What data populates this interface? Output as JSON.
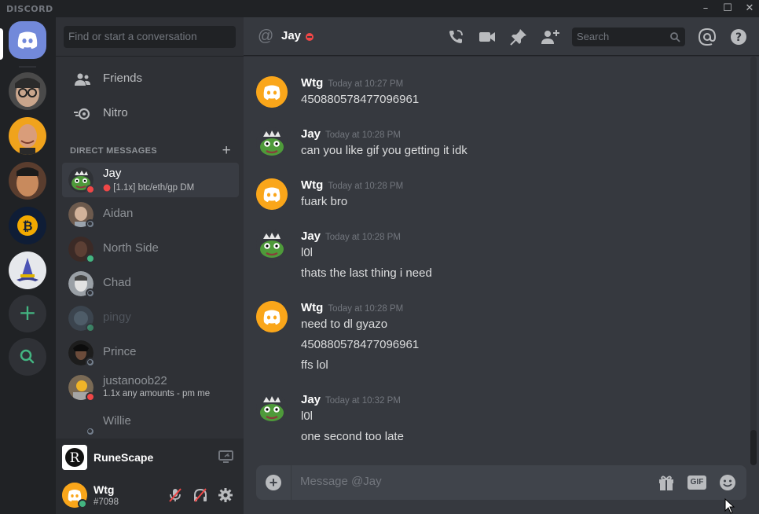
{
  "app": {
    "brand": "DISCORD"
  },
  "window_controls": {
    "minimize": "–",
    "maximize": "☐",
    "close": "✕"
  },
  "servers": [
    {
      "name": "home",
      "icon": "discord-logo-icon"
    },
    {
      "name": "server-1",
      "icon": "avatar-glasses"
    },
    {
      "name": "server-2",
      "icon": "avatar-smiling"
    },
    {
      "name": "server-3",
      "icon": "avatar-face"
    },
    {
      "name": "server-4",
      "icon": "bitcoin-icon"
    },
    {
      "name": "server-5",
      "icon": "wizard-hat-icon"
    }
  ],
  "rail_actions": {
    "add": "+",
    "explore_icon": "search-icon"
  },
  "sidebar": {
    "search_placeholder": "Find or start a conversation",
    "nav": [
      {
        "label": "Friends",
        "icon": "friends-icon"
      },
      {
        "label": "Nitro",
        "icon": "nitro-icon"
      }
    ],
    "dm_header": "DIRECT MESSAGES",
    "dm_add": "+",
    "dms": [
      {
        "name": "Jay",
        "sub": "[1.1x] btc/eth/gp DM",
        "status": "dnd",
        "active": true,
        "avatar_color": "#3a8a3a"
      },
      {
        "name": "Aidan",
        "sub": "",
        "status": "offline",
        "active": false,
        "avatar_color": "#6d5a4d"
      },
      {
        "name": "North Side",
        "sub": "",
        "status": "online",
        "active": false,
        "avatar_color": "#3b2a26"
      },
      {
        "name": "Chad",
        "sub": "",
        "status": "offline",
        "active": false,
        "avatar_color": "#9aa0a6"
      },
      {
        "name": "pingy",
        "sub": "",
        "status": "online",
        "active": false,
        "avatar_color": "#4a5d6b"
      },
      {
        "name": "Prince",
        "sub": "",
        "status": "offline",
        "active": false,
        "avatar_color": "#1d1d1d"
      },
      {
        "name": "justanoob22",
        "sub": "1.1x any amounts - pm me",
        "status": "dnd",
        "active": false,
        "avatar_color": "#c48a2b"
      },
      {
        "name": "Willie",
        "sub": "",
        "status": "offline",
        "active": false,
        "avatar_color": "#2f3136"
      }
    ],
    "activity": {
      "game": "RuneScape",
      "icon_letter": "R"
    },
    "user": {
      "name": "Wtg",
      "tag": "#7098",
      "status": "online"
    }
  },
  "chat": {
    "recipient": "Jay",
    "recipient_status": "dnd",
    "search_placeholder": "Search",
    "header_icons": [
      "call-icon",
      "video-icon",
      "pin-icon",
      "add-friend-icon",
      "mention-icon",
      "help-icon"
    ],
    "messages": [
      {
        "author": "Wtg",
        "time": "Today at 10:27 PM",
        "lines": [
          "450880578477096961"
        ]
      },
      {
        "author": "Jay",
        "time": "Today at 10:28 PM",
        "lines": [
          "can you like gif you getting it idk"
        ]
      },
      {
        "author": "Wtg",
        "time": "Today at 10:28 PM",
        "lines": [
          "fuark bro"
        ]
      },
      {
        "author": "Jay",
        "time": "Today at 10:28 PM",
        "lines": [
          "l0l",
          "thats the last thing i need"
        ]
      },
      {
        "author": "Wtg",
        "time": "Today at 10:28 PM",
        "lines": [
          "need to dl gyazo",
          "450880578477096961",
          "ffs lol"
        ]
      },
      {
        "author": "Jay",
        "time": "Today at 10:32 PM",
        "lines": [
          "l0l",
          "one second too late"
        ]
      }
    ],
    "composer_placeholder": "Message @Jay",
    "gif_label": "GIF"
  },
  "colors": {
    "blurple": "#7289da",
    "online": "#43b581",
    "dnd": "#f04747",
    "offline": "#747f8d",
    "wtg_avatar": "#faa61a"
  }
}
